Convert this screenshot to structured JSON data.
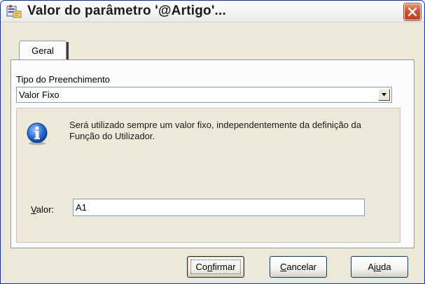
{
  "window": {
    "title": "Valor do parâmetro '@Artigo'...",
    "app_icon": "parameter-app-icon",
    "close_icon": "close-icon"
  },
  "tabs": [
    {
      "label": "Geral",
      "active": true
    }
  ],
  "form": {
    "fill_type_label": "Tipo do Preenchimento",
    "fill_type_value": "Valor Fixo",
    "dropdown_icon": "chevron-down-icon",
    "info_icon": "info-icon",
    "info_text": "Será utilizado sempre um valor fixo, independentemente da definição da Função do Utilizador.",
    "value_label_mnemonic": "V",
    "value_label_rest": "alor:",
    "value_input": "A1"
  },
  "buttons": {
    "confirm_pre": "Co",
    "confirm_mnemonic": "n",
    "confirm_post": "firmar",
    "cancel_mnemonic": "C",
    "cancel_post": "ancelar",
    "help_pre": "Aj",
    "help_mnemonic": "u",
    "help_post": "da"
  },
  "colors": {
    "dialog_background": "#ece9d8",
    "close_button": "#d8502e",
    "info_blue": "#2a6fd6"
  }
}
